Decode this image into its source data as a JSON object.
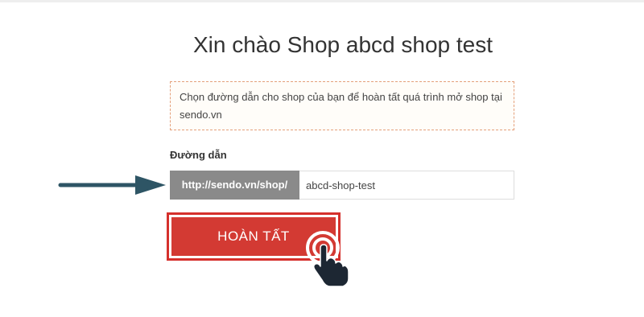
{
  "page": {
    "title": "Xin chào Shop abcd shop test"
  },
  "notice": {
    "text": "Chọn đường dẫn cho shop của bạn để hoàn tất quá trình mở shop tại sendo.vn"
  },
  "url_field": {
    "label": "Đường dẫn",
    "prefix": "http://sendo.vn/shop/",
    "value": "abcd-shop-test"
  },
  "submit": {
    "label": "HOÀN TẤT"
  },
  "icons": {
    "pointer_arrow": "arrow-right-icon",
    "cursor": "hand-pointer-icon"
  },
  "colors": {
    "button": "#d33a33",
    "button_border": "#d5302c",
    "notice_border": "#e4a07a",
    "prefix_bg": "#8a8a8a",
    "arrow": "#2e5565"
  }
}
